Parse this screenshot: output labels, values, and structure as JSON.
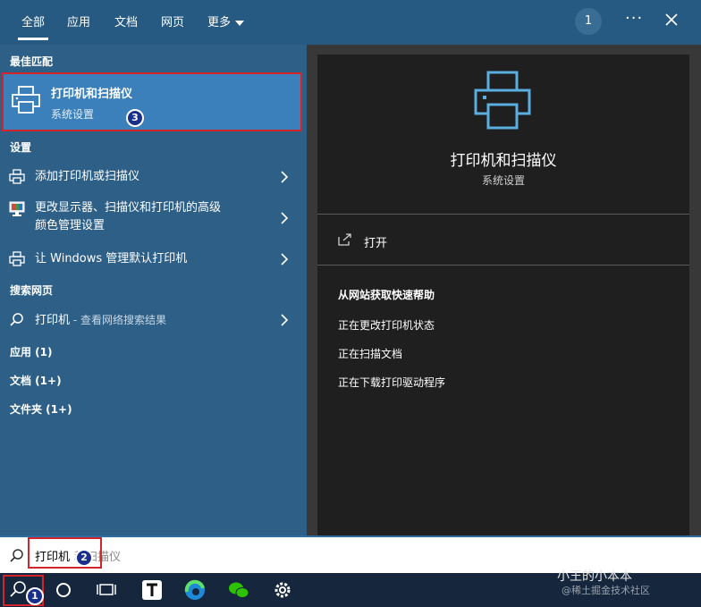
{
  "tabs": [
    {
      "label": "全部",
      "active": true
    },
    {
      "label": "应用"
    },
    {
      "label": "文档"
    },
    {
      "label": "网页"
    },
    {
      "label": "更多"
    }
  ],
  "header": {
    "badge": "1",
    "more_icon": "ellipsis-icon",
    "close_icon": "close-icon"
  },
  "left": {
    "best_match_heading": "最佳匹配",
    "best_match": {
      "title": "打印机和扫描仪",
      "subtitle": "系统设置",
      "icon": "printer-icon"
    },
    "settings_heading": "设置",
    "settings_items": [
      {
        "label": "添加打印机或扫描仪",
        "icon": "printer-icon"
      },
      {
        "label_line1": "更改显示器、扫描仪和打印机的高级",
        "label_line2": "颜色管理设置",
        "icon": "monitor-icon"
      },
      {
        "label": "让 Windows 管理默认打印机",
        "icon": "printer-icon"
      }
    ],
    "web_heading": "搜索网页",
    "web_item": {
      "label": "打印机",
      "sub": " - 查看网络搜索结果",
      "icon": "search-icon"
    },
    "apps": "应用 (1)",
    "docs": "文档 (1+)",
    "folders": "文件夹 (1+)"
  },
  "right": {
    "title": "打印机和扫描仪",
    "subtitle": "系统设置",
    "open_label": "打开",
    "help_heading": "从网站获取快速帮助",
    "help_links": [
      "正在更改打印机状态",
      "正在扫描文档",
      "正在下载打印驱动程序"
    ]
  },
  "search": {
    "typed": "打印机",
    "placeholder": "和扫描仪"
  },
  "markers": [
    "1",
    "2",
    "3"
  ],
  "watermark": {
    "line1": "小王的小本本",
    "line2": "@稀土掘金技术社区"
  },
  "colors": {
    "accent": "#3b80bb",
    "highlight_border": "#d4242b",
    "marker": "#1a2f8c"
  }
}
